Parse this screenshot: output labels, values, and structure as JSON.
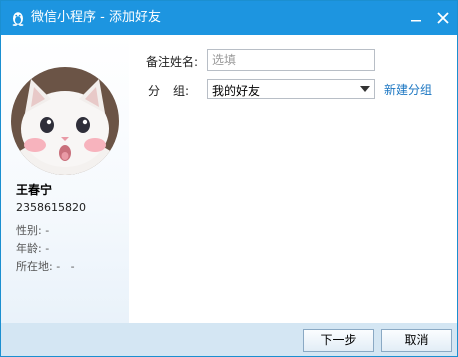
{
  "window": {
    "title": "微信小程序 - 添加好友"
  },
  "icons": {
    "app": "qq-penguin-icon",
    "minimize": "minimize-icon",
    "close": "close-icon",
    "dropdown": "dropdown-arrow-icon"
  },
  "colors": {
    "titlebar": "#1d95e0",
    "footer": "#d4e6f3",
    "link": "#1b76c2"
  },
  "profile": {
    "name": "王春宁",
    "id": "2358615820",
    "gender_label": "性别:",
    "gender_value": "-",
    "age_label": "年龄:",
    "age_value": "-",
    "location_label": "所在地:",
    "location_value": "-   -"
  },
  "form": {
    "remark_label": "备注姓名:",
    "remark_value": "",
    "remark_placeholder": "选填",
    "group_label_1": "分",
    "group_label_2": "组:",
    "group_selected": "我的好友",
    "new_group_link": "新建分组"
  },
  "footer": {
    "next_label": "下一步",
    "cancel_label": "取消"
  }
}
